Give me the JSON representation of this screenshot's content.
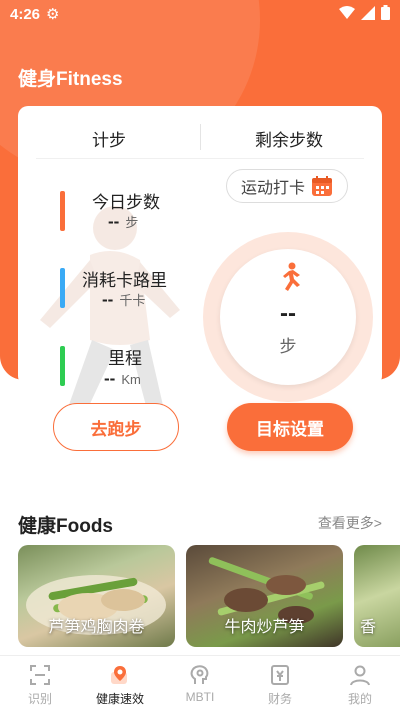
{
  "status_bar": {
    "time": "4:26"
  },
  "page_title": "健身Fitness",
  "tabs": {
    "steps": "计步",
    "remaining_steps": "剩余步数"
  },
  "checkin": {
    "label": "运动打卡"
  },
  "metrics": [
    {
      "label": "今日步数",
      "value": "--",
      "unit": "步",
      "color": "#fa6e3a"
    },
    {
      "label": "消耗卡路里",
      "value": "--",
      "unit": "千卡",
      "color": "#3aaaf5"
    },
    {
      "label": "里程",
      "value": "--",
      "unit": "Km",
      "color": "#2ecc52"
    }
  ],
  "ring": {
    "value": "--",
    "unit": "步"
  },
  "buttons": {
    "run": "去跑步",
    "goal": "目标设置"
  },
  "foods_section": {
    "title": "健康Foods",
    "see_more": "查看更多>"
  },
  "foods": [
    {
      "label": "芦笋鸡胸肉卷"
    },
    {
      "label": "牛肉炒芦笋"
    },
    {
      "label": "香"
    }
  ],
  "nav": [
    {
      "label": "识别",
      "icon": "scan-icon",
      "active": false
    },
    {
      "label": "健康速效",
      "icon": "health-icon",
      "active": true
    },
    {
      "label": "MBTI",
      "icon": "brain-icon",
      "active": false
    },
    {
      "label": "财务",
      "icon": "finance-icon",
      "active": false
    },
    {
      "label": "我的",
      "icon": "profile-icon",
      "active": false
    }
  ],
  "colors": {
    "accent": "#fa6e3a"
  }
}
